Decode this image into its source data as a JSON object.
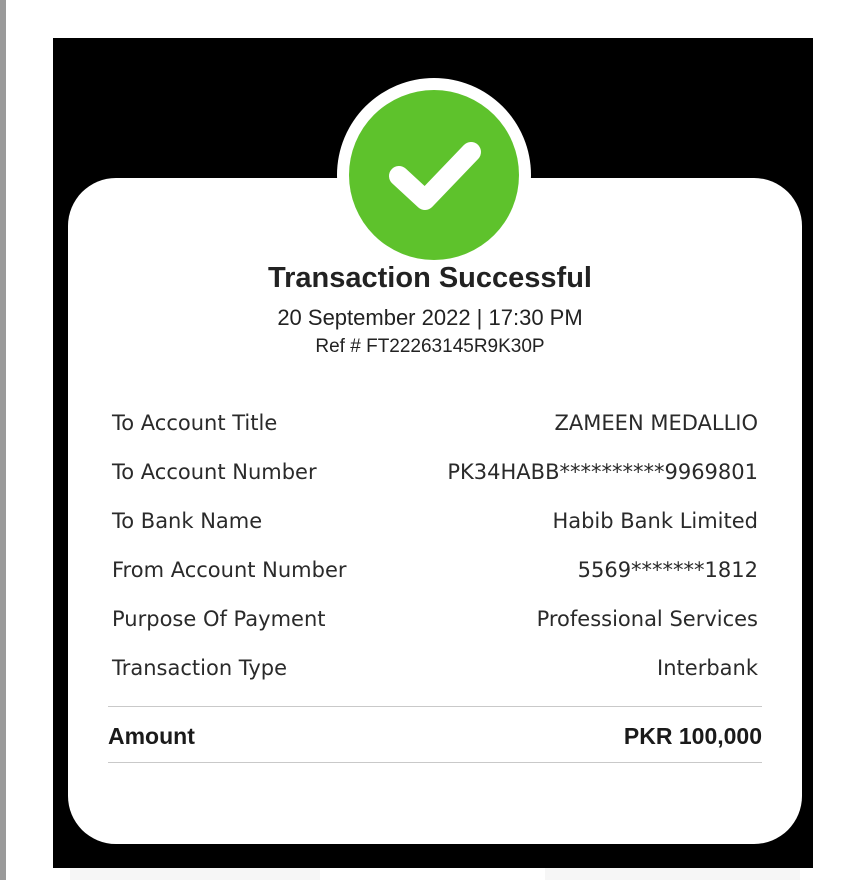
{
  "receipt": {
    "status_icon": "check-icon",
    "success_color": "#5ec22c",
    "title": "Transaction Successful",
    "datetime": "20 September 2022 | 17:30 PM",
    "ref": "Ref # FT22263145R9K30P",
    "details": [
      {
        "label": "To Account Title",
        "value": "ZAMEEN MEDALLIO"
      },
      {
        "label": "To Account Number",
        "value": "PK34HABB**********9969801"
      },
      {
        "label": "To Bank Name",
        "value": "Habib Bank Limited"
      },
      {
        "label": "From Account Number",
        "value": "5569*******1812"
      },
      {
        "label": "Purpose Of Payment",
        "value": "Professional Services"
      },
      {
        "label": "Transaction Type",
        "value": "Interbank"
      }
    ],
    "amount": {
      "label": "Amount",
      "value": "PKR 100,000"
    }
  }
}
